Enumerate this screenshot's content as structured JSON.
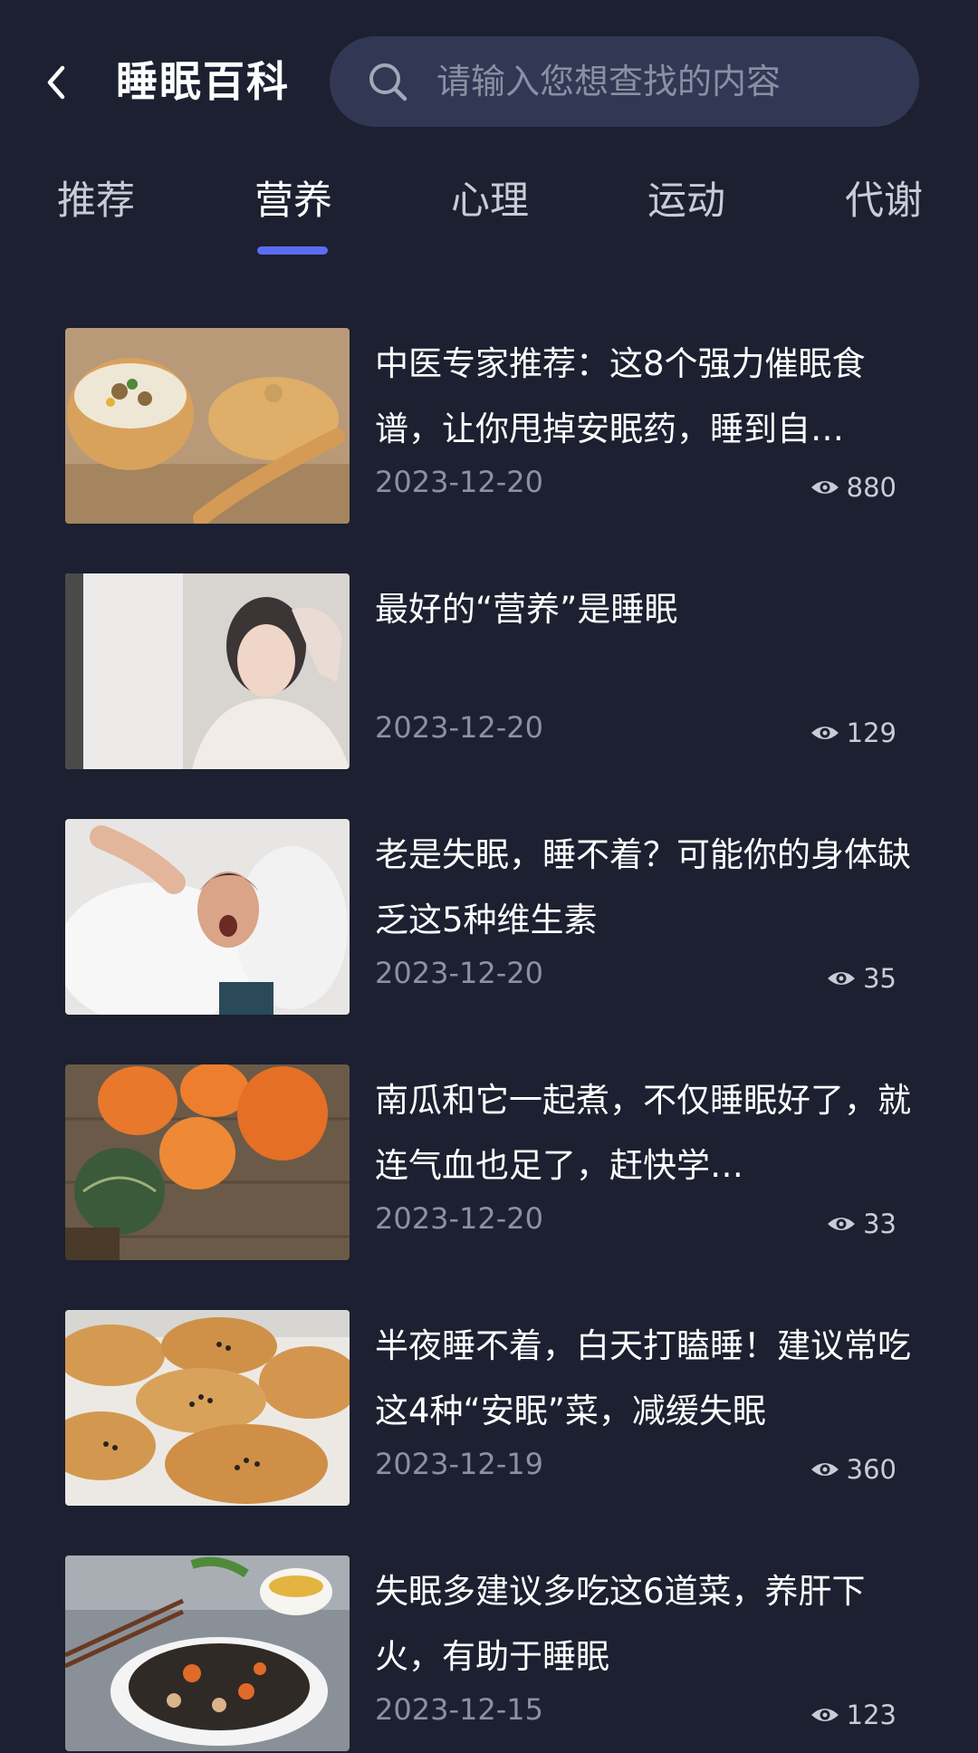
{
  "header": {
    "title": "睡眠百科",
    "back_icon": "chevron-left-icon",
    "search_placeholder": "请输入您想查找的内容",
    "search_icon": "search-icon"
  },
  "tabs": [
    {
      "label": "推荐",
      "active": false
    },
    {
      "label": "营养",
      "active": true
    },
    {
      "label": "心理",
      "active": false
    },
    {
      "label": "运动",
      "active": false
    },
    {
      "label": "代谢",
      "active": false
    }
  ],
  "articles": [
    {
      "title": "中医专家推荐：这8个强力催眠食谱，让你甩掉安眠药，睡到自…",
      "date": "2023-12-20",
      "views": "880",
      "thumbnail": "porridge-bowl-image"
    },
    {
      "title": "最好的“营养”是睡眠",
      "date": "2023-12-20",
      "views": "129",
      "thumbnail": "tired-woman-image"
    },
    {
      "title": "老是失眠，睡不着？可能你的身体缺乏这5种维生素",
      "date": "2023-12-20",
      "views": "35",
      "thumbnail": "man-with-pillow-image"
    },
    {
      "title": "南瓜和它一起煮，不仅睡眠好了，就连气血也足了，赶快学…",
      "date": "2023-12-20",
      "views": "33",
      "thumbnail": "pumpkins-image"
    },
    {
      "title": "半夜睡不着，白天打瞌睡！建议常吃这4种“安眠”菜，减缓失眠",
      "date": "2023-12-19",
      "views": "360",
      "thumbnail": "sesame-cakes-image"
    },
    {
      "title": "失眠多建议多吃这6道菜，养肝下火，有助于睡眠",
      "date": "2023-12-15",
      "views": "123",
      "thumbnail": "stir-fry-dish-image"
    }
  ],
  "colors": {
    "background": "#1c2030",
    "search_bg": "#323753",
    "accent": "#5a6cf0",
    "date_text": "#8c90a0"
  }
}
